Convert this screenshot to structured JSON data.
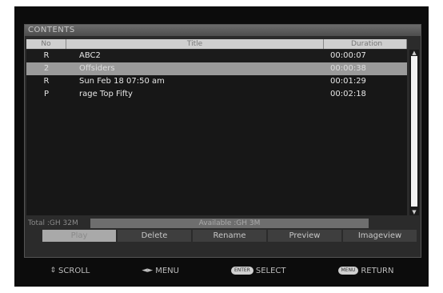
{
  "panel": {
    "title": "CONTENTS"
  },
  "columns": {
    "no": "No",
    "title": "Title",
    "duration": "Duration"
  },
  "rows": [
    {
      "no": "R",
      "title": "ABC2",
      "duration": "00:00:07",
      "state": "dark"
    },
    {
      "no": "2",
      "title": "Offsiders",
      "duration": "00:00:38",
      "state": "selected"
    },
    {
      "no": "R",
      "title": "Sun Feb 18 07:50 am",
      "duration": "00:01:29",
      "state": "normal"
    },
    {
      "no": "P",
      "title": "rage Top Fifty",
      "duration": "00:02:18",
      "state": "normal"
    }
  ],
  "storage": {
    "total_label": "Total :GH 32M",
    "available_label": "Available :GH 3M"
  },
  "buttons": {
    "play": "Play",
    "delete": "Delete",
    "rename": "Rename",
    "preview": "Preview",
    "imageview": "Imageview"
  },
  "hints": {
    "scroll": "SCROLL",
    "menu": "MENU",
    "select_key": "ENTER",
    "select": "SELECT",
    "return_key": "MENU",
    "return": "RETURN"
  },
  "icons": {
    "scroll": "up-down-arrow-icon",
    "menu": "left-right-arrow-icon",
    "select": "enter-key-icon",
    "return": "menu-key-icon"
  }
}
